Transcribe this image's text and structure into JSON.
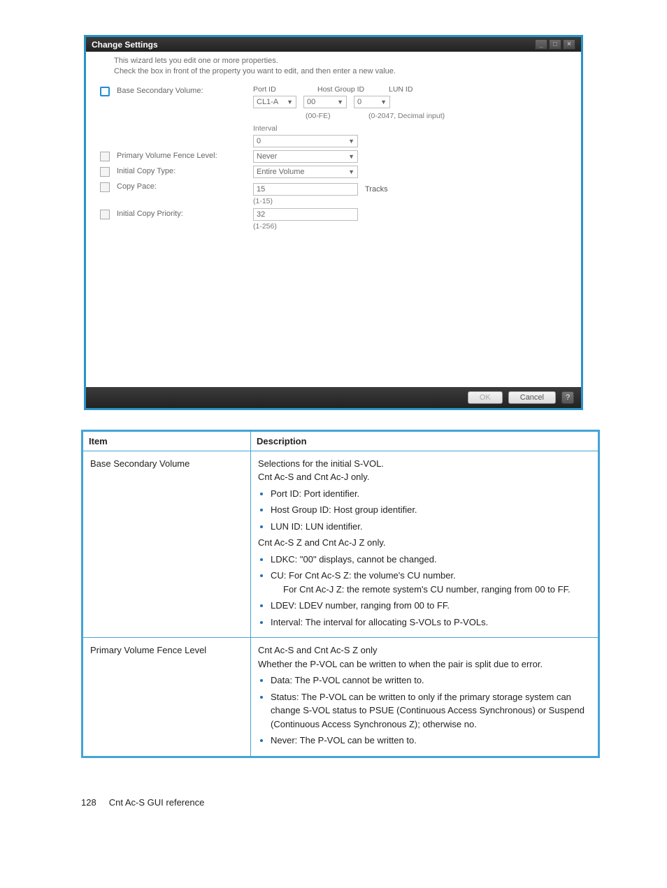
{
  "wizard": {
    "title": "Change Settings",
    "instr1": "This wizard lets you edit one or more properties.",
    "instr2": "Check the box in front of the property you want to edit, and then enter a new value.",
    "baseSecVol": {
      "label": "Base Secondary Volume:",
      "portIdLabel": "Port ID",
      "hostGroupLabel": "Host Group ID",
      "lunIdLabel": "LUN ID",
      "portIdValue": "CL1-A",
      "hostGroupValue": "00",
      "hostGroupHint": "(00-FE)",
      "lunIdValue": "0",
      "lunIdHint": "(0-2047, Decimal input)",
      "intervalLabel": "Interval",
      "intervalValue": "0"
    },
    "fenceLevel": {
      "label": "Primary Volume Fence Level:",
      "value": "Never"
    },
    "copyType": {
      "label": "Initial Copy Type:",
      "value": "Entire Volume"
    },
    "copyPace": {
      "label": "Copy Pace:",
      "value": "15",
      "unit": "Tracks",
      "hint": "(1-15)"
    },
    "copyPriority": {
      "label": "Initial Copy Priority:",
      "value": "32",
      "hint": "(1-256)"
    },
    "buttons": {
      "ok": "OK",
      "cancel": "Cancel"
    }
  },
  "table": {
    "header_item": "Item",
    "header_desc": "Description",
    "row1": {
      "item": "Base Secondary Volume",
      "p1": "Selections for the initial S-VOL.",
      "p2": "Cnt Ac-S and Cnt Ac-J only.",
      "b1": "Port ID: Port identifier.",
      "b2": "Host Group ID: Host group identifier.",
      "b3": "LUN ID: LUN identifier.",
      "p3": "Cnt Ac-S Z and Cnt Ac-J Z only.",
      "b4": "LDKC: \"00\" displays, cannot be changed.",
      "b5": "CU: For Cnt Ac-S Z: the volume's CU number.",
      "b5b": "For Cnt Ac-J Z: the remote system's CU number, ranging from 00 to FF.",
      "b6": "LDEV: LDEV number, ranging from 00 to FF.",
      "b7": "Interval: The interval for allocating S-VOLs to P-VOLs."
    },
    "row2": {
      "item": "Primary Volume Fence Level",
      "p1": "Cnt Ac-S and Cnt Ac-S Z only",
      "p2": "Whether the P-VOL can be written to when the pair is split due to error.",
      "b1": "Data: The P-VOL cannot be written to.",
      "b2": "Status: The P-VOL can be written to only if the primary storage system can change S-VOL status to PSUE (Continuous Access Synchronous) or Suspend (Continuous Access Synchronous Z); otherwise no.",
      "b3": "Never: The P-VOL can be written to."
    }
  },
  "footer": {
    "page": "128",
    "section": "Cnt Ac-S GUI reference"
  }
}
